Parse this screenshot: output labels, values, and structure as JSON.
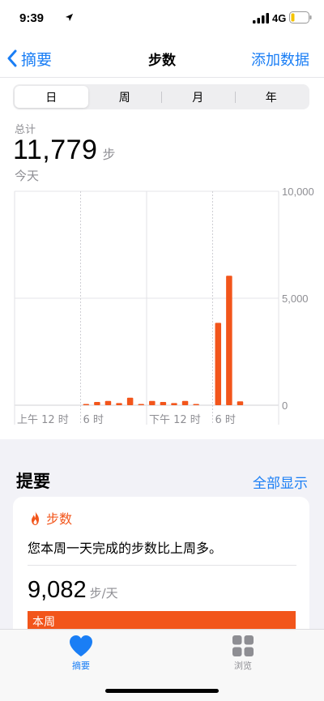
{
  "status_bar": {
    "time": "9:39",
    "network": "4G"
  },
  "nav": {
    "back_label": "摘要",
    "title": "步数",
    "add_label": "添加数据"
  },
  "segments": [
    "日",
    "周",
    "月",
    "年"
  ],
  "summary": {
    "total_label": "总计",
    "total_value": "11,779",
    "unit": "步",
    "date": "今天"
  },
  "chart_data": {
    "type": "bar",
    "x_tick_labels": [
      "上午 12 时",
      "6 时",
      "下午 12 时",
      "6 时"
    ],
    "y_tick_labels": [
      "10,000",
      "5,000",
      "0"
    ],
    "ylim": [
      0,
      10000
    ],
    "x": [
      6,
      7,
      8,
      9,
      10,
      11,
      12,
      13,
      14,
      15,
      16,
      18,
      19,
      20
    ],
    "values": [
      40,
      150,
      200,
      100,
      350,
      40,
      200,
      150,
      100,
      200,
      40,
      3850,
      6050,
      180
    ],
    "grid": true,
    "color": "#f2551b"
  },
  "highlights": {
    "title": "提要",
    "show_all": "全部显示",
    "card": {
      "category": "步数",
      "text": "您本周一天完成的步数比上周多。",
      "average": "9,082",
      "average_unit": "步/天",
      "bar_label": "本周"
    }
  },
  "tabs": [
    {
      "label": "摘要",
      "icon": "heart-icon",
      "selected": true
    },
    {
      "label": "浏览",
      "icon": "grid-icon",
      "selected": false
    }
  ],
  "colors": {
    "accent": "#1a7ef5",
    "steps": "#f2551b"
  }
}
